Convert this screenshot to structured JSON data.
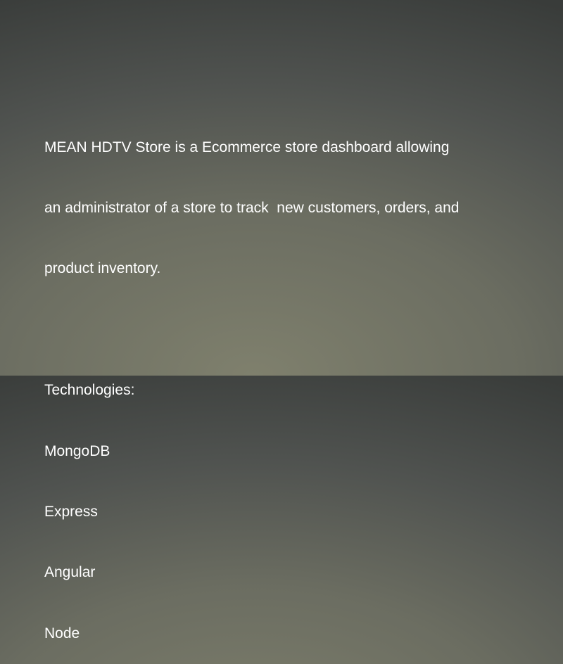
{
  "description": {
    "lines": [
      "MEAN HDTV Store is a Ecommerce store dashboard allowing",
      "an administrator of a store to track  new customers, orders, and",
      "product inventory."
    ]
  },
  "technologies": {
    "heading": "Technologies:",
    "items": [
      "MongoDB",
      "Express",
      "Angular",
      "Node"
    ]
  }
}
